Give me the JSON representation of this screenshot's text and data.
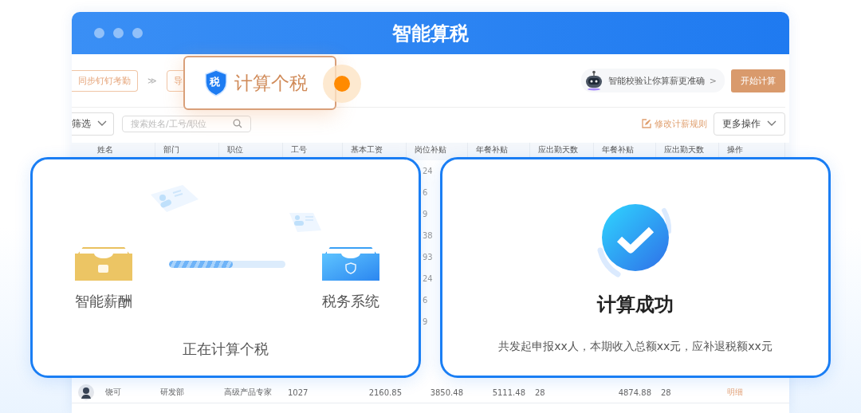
{
  "window": {
    "title": "智能算税"
  },
  "toolbar": {
    "steps": [
      {
        "label": "同步钉钉考勤"
      },
      {
        "label": "导"
      }
    ],
    "step_arrow": "≫",
    "tip": "智能校验让你算薪更准确",
    "tip_arrow": ">",
    "primary": "开始计算"
  },
  "popup": {
    "badge": "税",
    "label": "计算个税"
  },
  "filters": {
    "filter": "筛选",
    "search": {
      "placeholder": "搜索姓名/工号/职位"
    },
    "edit_rules": "修改计薪规则",
    "more": "更多操作"
  },
  "table": {
    "columns": [
      "姓名",
      "部门",
      "职位",
      "工号",
      "基本工资",
      "岗位补贴",
      "年餐补贴",
      "应出勤天数",
      "年餐补贴",
      "应出勤天数",
      "操作"
    ],
    "peek_cells": [
      "24",
      "6",
      "9",
      "38",
      "93",
      "24",
      "6",
      "9"
    ],
    "rows": [
      {
        "cells": [
          "饶可",
          "研发部",
          "高级产品专家",
          "1027",
          "2160.85",
          "3850.48",
          "5111.48",
          "28",
          "4874.88",
          "28"
        ],
        "action": "明细"
      }
    ]
  },
  "progress_card": {
    "source": "智能薪酬",
    "target": "税务系统",
    "level": 0.55,
    "status": "正在计算个税"
  },
  "result_card": {
    "title": "计算成功",
    "message": "共发起申报xx人，本期收入总额xx元，应补退税额xx元"
  }
}
